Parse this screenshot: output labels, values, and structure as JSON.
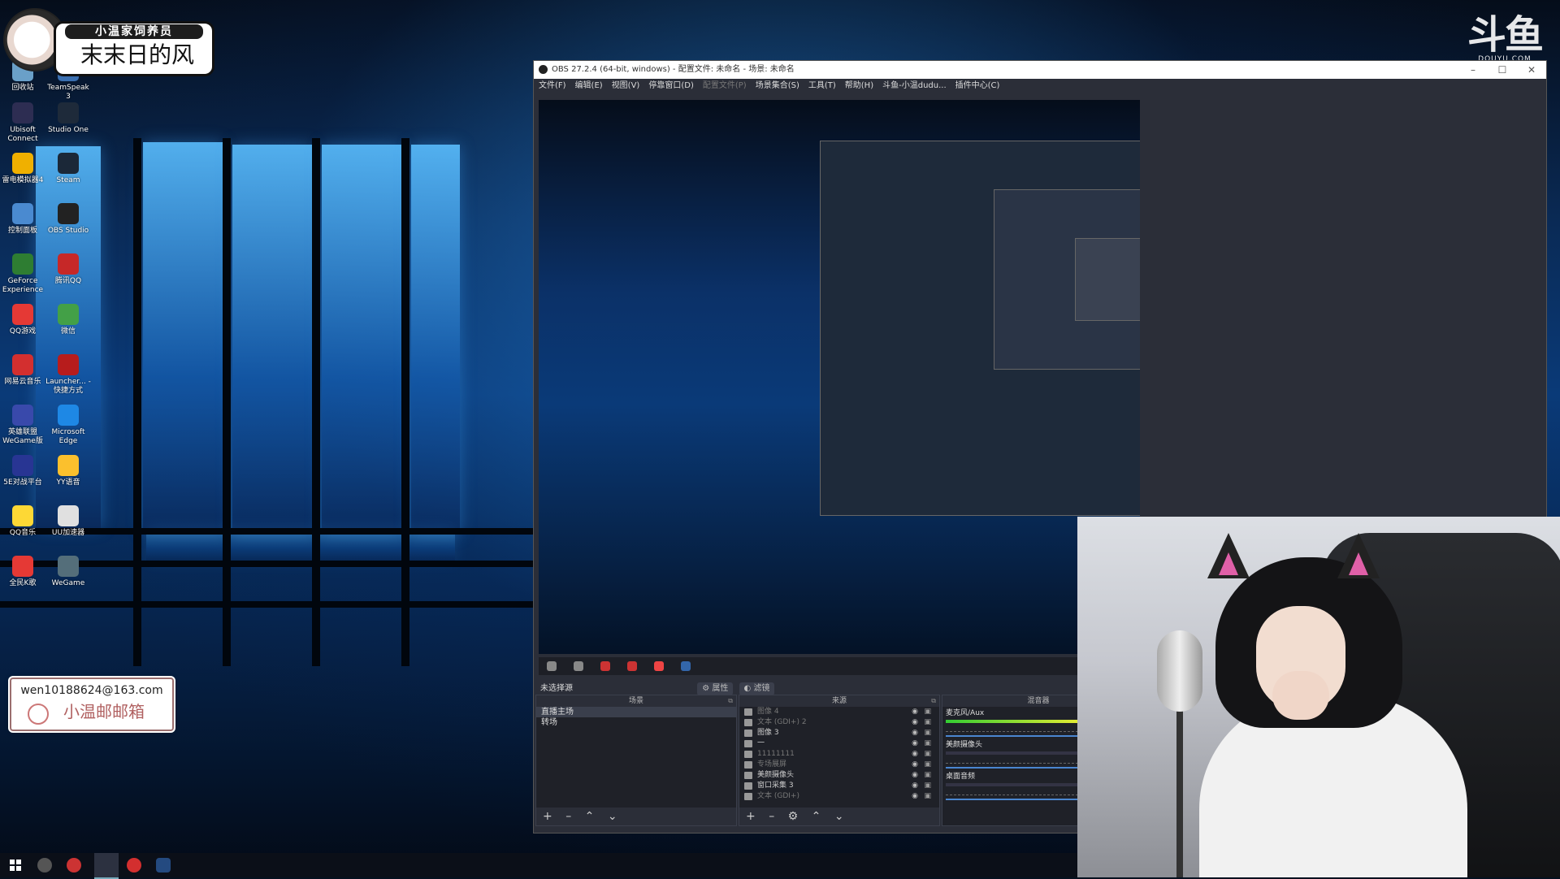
{
  "overlay": {
    "badge_small": "小温家饲养员",
    "badge_big": "末末日的风",
    "brand_logo": "斗鱼",
    "brand_site": "DOUYU.COM",
    "email_address": "wen10188624@163.com",
    "email_name": "小温邮邮箱"
  },
  "desktop_icons": [
    {
      "label": "回收站",
      "color": "#6aa0c8"
    },
    {
      "label": "TeamSpeak 3",
      "color": "#3a6fb0"
    },
    {
      "label": "Ubisoft Connect",
      "color": "#2d2d52"
    },
    {
      "label": "Studio One",
      "color": "#1e2a3a"
    },
    {
      "label": "雷电模拟器4",
      "color": "#f0b000"
    },
    {
      "label": "Steam",
      "color": "#1b2838"
    },
    {
      "label": "控制面板",
      "color": "#4a8ad0"
    },
    {
      "label": "OBS Studio",
      "color": "#222222"
    },
    {
      "label": "GeForce Experience",
      "color": "#2e7d32"
    },
    {
      "label": "腾讯QQ",
      "color": "#c62828"
    },
    {
      "label": "QQ游戏",
      "color": "#e53935"
    },
    {
      "label": "微信",
      "color": "#43a047"
    },
    {
      "label": "网易云音乐",
      "color": "#d32f2f"
    },
    {
      "label": "Launcher... - 快捷方式",
      "color": "#b71c1c"
    },
    {
      "label": "英雄联盟WeGame版",
      "color": "#3949ab"
    },
    {
      "label": "Microsoft Edge",
      "color": "#1e88e5"
    },
    {
      "label": "5E对战平台",
      "color": "#283593"
    },
    {
      "label": "YY语音",
      "color": "#fbc02d"
    },
    {
      "label": "QQ音乐",
      "color": "#fdd835"
    },
    {
      "label": "UU加速器",
      "color": "#e0e0e0"
    },
    {
      "label": "全民K歌",
      "color": "#e53935"
    },
    {
      "label": "WeGame",
      "color": "#546e7a"
    }
  ],
  "obs": {
    "title": "OBS 27.2.4 (64-bit, windows) - 配置文件: 未命名 - 场景: 未命名",
    "menu": [
      "文件(F)",
      "编辑(E)",
      "视图(V)",
      "停靠窗口(D)",
      "配置文件(P)",
      "场景集合(S)",
      "工具(T)",
      "帮助(H)",
      "斗鱼-小温dudu...",
      "插件中心(C)"
    ],
    "no_source": "未选择源",
    "properties_btn": "属性",
    "filters_btn": "滤镜",
    "scenes_header": "场景",
    "sources_header": "来源",
    "mixer_header": "混音器",
    "scenes": [
      "直播主场",
      "转场"
    ],
    "sources": [
      {
        "label": "图像 4",
        "dim": true
      },
      {
        "label": "文本 (GDI+) 2",
        "dim": true
      },
      {
        "label": "图像 3",
        "dim": false
      },
      {
        "label": "一",
        "dim": false
      },
      {
        "label": "11111111",
        "dim": true
      },
      {
        "label": "专场展屏",
        "dim": true
      },
      {
        "label": "美颜摄像头",
        "dim": false
      },
      {
        "label": "窗口采集 3",
        "dim": false
      },
      {
        "label": "文本 (GDI+)",
        "dim": true
      }
    ],
    "mixer": [
      {
        "label": "麦克风/Aux",
        "level": 0.95
      },
      {
        "label": "美颜摄像头",
        "level": 0.0
      },
      {
        "label": "桌面音频",
        "level": 0.0
      }
    ]
  }
}
